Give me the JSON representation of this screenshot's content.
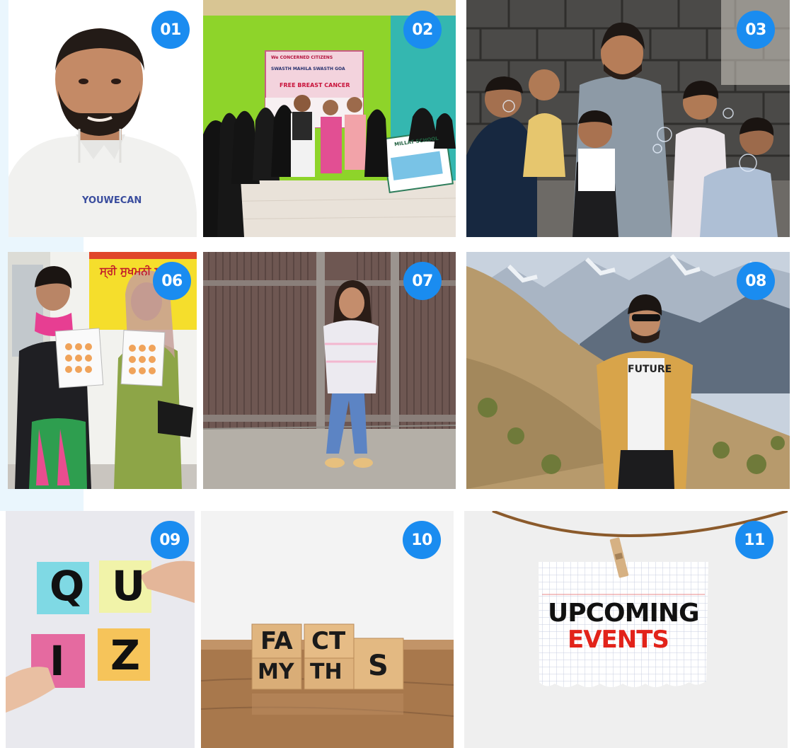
{
  "tiles": [
    {
      "badge": "01",
      "text": {
        "shirt_logo": "YOUWECAN"
      }
    },
    {
      "badge": "02",
      "text": {
        "banner_top": "We CONCERNED CITIZENS",
        "banner_mid": "SWASTH MAHILA SWASTH GOA",
        "banner_main": "FREE BREAST CANCER",
        "sign": "MILLAT SCHOOL"
      }
    },
    {
      "badge": "03"
    },
    {
      "badge": "06",
      "text": {
        "banner": "ਸ੍ਰੀ ਸੁਖਮਨੀ ਸਾਹਿਬ"
      }
    },
    {
      "badge": "07"
    },
    {
      "badge": "08",
      "text": {
        "shirt": "FUTURE"
      }
    },
    {
      "badge": "09",
      "text": {
        "q": "Q",
        "u": "U",
        "i": "I",
        "z": "Z"
      }
    },
    {
      "badge": "10",
      "text": {
        "top_left": "FA",
        "top_right": "CT",
        "bottom_left": "MY",
        "bottom_right": "TH",
        "end": "S"
      }
    },
    {
      "badge": "11",
      "text": {
        "line1": "UPCOMING",
        "line2": "EVENTS"
      }
    }
  ],
  "colors": {
    "badge": "#1a8cf0",
    "accent_bg": "#eaf6fd",
    "events_red": "#e2231a"
  }
}
